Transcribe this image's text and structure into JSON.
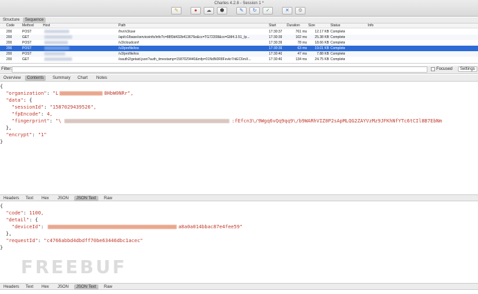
{
  "window": {
    "title": "Charles 4.2.8 - Session 1 *"
  },
  "toolbar": {
    "icons": [
      "brush-icon",
      "record-icon",
      "turtle-icon",
      "stop-icon",
      "pen-icon",
      "refresh-icon",
      "check-icon",
      "tools-icon",
      "settings-icon"
    ],
    "glyphs": [
      "✎",
      "●",
      "☁",
      "⬢",
      "✎",
      "↻",
      "✓",
      "✕",
      "⚙"
    ]
  },
  "view_tabs": {
    "structure": "Structure",
    "sequence": "Sequence"
  },
  "table": {
    "headers": {
      "code": "Code",
      "method": "Method",
      "host": "Host",
      "path": "Path",
      "start": "Start",
      "duration": "Duration",
      "size": "Size",
      "status": "Status",
      "info": "Info"
    },
    "rows": [
      {
        "code": "200",
        "method": "POST",
        "path": "/hvr/v3/use",
        "start": "17:30:37",
        "duration": "761 ms",
        "size": "12.17 KB",
        "status": "Complete"
      },
      {
        "code": "200",
        "method": "GET",
        "path": "/api/v1/base/serviceinfo/info?c=88f3d432b413676e&cc=TG72208&cv=GM4.3.51_Ip...",
        "start": "17:30:39",
        "duration": "102 ms",
        "size": "25.38 KB",
        "status": "Complete"
      },
      {
        "code": "200",
        "method": "POST",
        "path": "/v3/cloudconf",
        "start": "17:30:39",
        "duration": "78 ms",
        "size": "18.66 KB",
        "status": "Complete"
      },
      {
        "code": "200",
        "method": "POST",
        "path": "/v3/profile/ios",
        "start": "17:30:39",
        "duration": "63 ms",
        "size": "19.01 KB",
        "status": "Complete"
      },
      {
        "code": "200",
        "method": "POST",
        "path": "/v3/profile/ios",
        "start": "17:30:40",
        "duration": "47 ms",
        "size": "7.88 KB",
        "status": "Complete"
      },
      {
        "code": "200",
        "method": "GET",
        "path": "/oauth2/getaid.json?auth_timestamp=1587029440&mfp=01NdN0R8Fevkr7rkEC6mX...",
        "start": "17:30:40",
        "duration": "134 ms",
        "size": "24.75 KB",
        "status": "Complete"
      }
    ]
  },
  "filter": {
    "label": "Filter:",
    "focused": "Focused",
    "settings": "Settings"
  },
  "detail_tabs": [
    "Overview",
    "Contents",
    "Summary",
    "Chart",
    "Notes"
  ],
  "request_body": {
    "l1": "{",
    "org_key": "\"organization\"",
    "org_val_start": "\"L",
    "org_val_end": "8HbW0NRr\",",
    "data_key": "\"data\"",
    "session_key": "\"sessionId\"",
    "session_val": "\"1587029439526\",",
    "fpencode_key": "\"fpEncode\"",
    "fpencode_val": "4,",
    "fingerprint_key": "\"fingerprint\"",
    "fingerprint_val_start": "\"\\",
    "fingerprint_val_end": ":fEfcn3\\/9Wgq6vQq9qq9\\/b9WARhVIZ0P2sApMLQG2ZAYVzMz9JFKhNfYTc6tCIl8B7EbNm",
    "close_data": "},",
    "encrypt_key": "\"encrypt\"",
    "encrypt_val": "\"1\"",
    "close": "}"
  },
  "mid_tabs": [
    "Headers",
    "Text",
    "Hex",
    "JSON",
    "JSON Text",
    "Raw"
  ],
  "response_body": {
    "l1": "{",
    "code_key": "\"code\"",
    "code_val": "1100,",
    "detail_key": "\"detail\"",
    "device_key": "\"deviceId\"",
    "device_val_end": "a8a0a014bbac87e4fee59\"",
    "close_detail": "},",
    "request_key": "\"requestId\"",
    "request_val": "\"c4766abbd4dbdff70be63446dbc1acec\"",
    "close": "}"
  },
  "bottom_tabs": [
    "Headers",
    "Text",
    "Hex",
    "JSON",
    "JSON Text",
    "Raw"
  ],
  "watermark": "FREEBUF"
}
